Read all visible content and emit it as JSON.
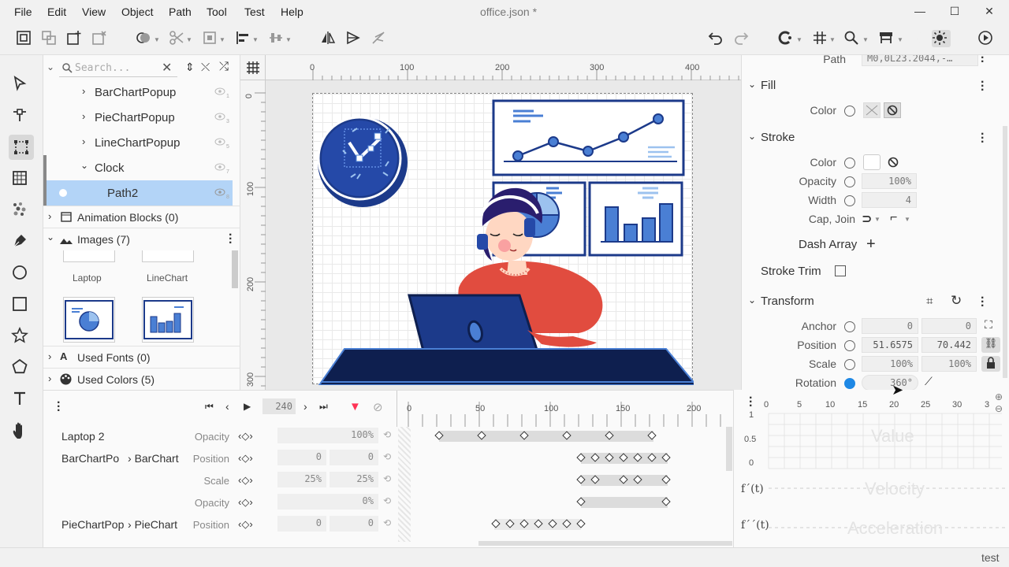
{
  "menu": {
    "items": [
      "File",
      "Edit",
      "View",
      "Object",
      "Path",
      "Tool",
      "Test",
      "Help"
    ],
    "doc_title": "office.json *"
  },
  "window": {
    "minimize": "—",
    "maximize": "☐",
    "close": "✕"
  },
  "layers": {
    "search_placeholder": "Search...",
    "items": [
      {
        "label": "BarChartPopup",
        "num": "1"
      },
      {
        "label": "PieChartPopup",
        "num": "3"
      },
      {
        "label": "LineChartPopup",
        "num": "5"
      },
      {
        "label": "Clock",
        "num": "7"
      },
      {
        "label": "Path2",
        "num": "8"
      }
    ],
    "animation_blocks": "Animation Blocks (0)",
    "images": "Images (7)",
    "image_thumbs": [
      "Laptop",
      "LineChart"
    ],
    "used_fonts": "Used Fonts (0)",
    "used_colors": "Used Colors (5)"
  },
  "ruler": {
    "h_labels": [
      "0",
      "100",
      "200",
      "300",
      "400"
    ],
    "v_labels": [
      "0",
      "100",
      "200",
      "300"
    ]
  },
  "props": {
    "path_label": "Path",
    "path_value": "M0,0L23.2044,-…",
    "fill": {
      "title": "Fill",
      "color_label": "Color"
    },
    "stroke": {
      "title": "Stroke",
      "color_label": "Color",
      "opacity_label": "Opacity",
      "opacity": "100%",
      "width_label": "Width",
      "width": "4",
      "cap_label": "Cap, Join",
      "dash_label": "Dash Array",
      "trim_label": "Stroke Trim"
    },
    "transform": {
      "title": "Transform",
      "anchor_label": "Anchor",
      "anchor_x": "0",
      "anchor_y": "0",
      "position_label": "Position",
      "position_x": "51.6575",
      "position_y": "70.442",
      "scale_label": "Scale",
      "scale_x": "100%",
      "scale_y": "100%",
      "rotation_label": "Rotation",
      "rotation": "360°"
    }
  },
  "timeline": {
    "frame": "240",
    "ruler": [
      "0",
      "50",
      "100",
      "150",
      "200"
    ],
    "rows": [
      {
        "name": "Laptop 2",
        "prop": "Opacity",
        "v1": "100%",
        "v2": ""
      },
      {
        "name": "BarChartPo",
        "name2": "BarChart",
        "prop": "Position",
        "v1": "0",
        "v2": "0"
      },
      {
        "name": "",
        "prop": "Scale",
        "v1": "25%",
        "v2": "25%"
      },
      {
        "name": "",
        "prop": "Opacity",
        "v1": "0%",
        "v2": ""
      },
      {
        "name": "PieChartPop",
        "name2": "PieChart",
        "prop": "Position",
        "v1": "0",
        "v2": "0"
      }
    ]
  },
  "curve": {
    "x_labels": [
      "0",
      "5",
      "10",
      "15",
      "20",
      "25",
      "30",
      "3"
    ],
    "y_labels": [
      "1",
      "0.5",
      "0"
    ],
    "value_label": "Value",
    "velocity_label": "Velocity",
    "acceleration_label": "Acceleration",
    "f1": "f´(t)",
    "f2": "f´´(t)"
  },
  "status": {
    "text": "test"
  },
  "colors": {
    "accent": "#1e88e5",
    "selection": "#b3d4f7",
    "navy": "#1c3a8a",
    "red": "#ff3355"
  }
}
